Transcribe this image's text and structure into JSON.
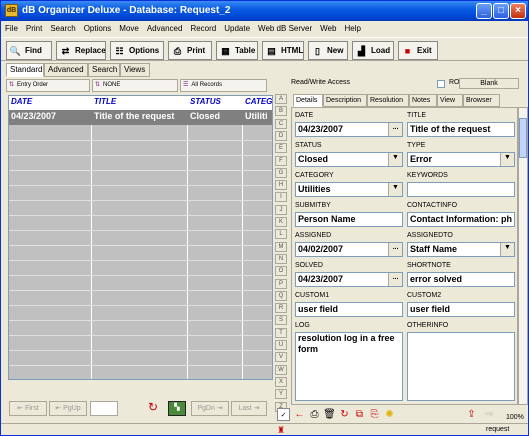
{
  "window": {
    "title": "dB Organizer Deluxe - Database: Request_2",
    "app_icon": "app-icon"
  },
  "menu": [
    "File",
    "Print",
    "Search",
    "Options",
    "Move",
    "Advanced",
    "Record",
    "Update",
    "Web dB Server",
    "Web",
    "Help"
  ],
  "toolbar": {
    "find": "Find",
    "replace": "Replace",
    "options": "Options",
    "print": "Print",
    "table": "Table",
    "html": "HTML",
    "new": "New",
    "load": "Load",
    "exit": "Exit"
  },
  "search_tabs": [
    "Standard",
    "Advanced",
    "Search",
    "Views"
  ],
  "sort_buttons": {
    "entry_order": "Entry Order",
    "none": "NONE",
    "all_records": "All Records"
  },
  "grid": {
    "columns": [
      "DATE",
      "TITLE",
      "STATUS",
      "CATEG"
    ],
    "rows": [
      [
        "04/23/2007",
        "Title of the request",
        "Closed",
        "Utiliti"
      ]
    ]
  },
  "nav": {
    "first": "First",
    "pgup": "PgUp",
    "pgdn": "PgDn",
    "last": "Last"
  },
  "form": {
    "access": "Read/Write Access",
    "ro": "RO",
    "blank": "Blank",
    "tabs": [
      "Details",
      "Description",
      "Resolution",
      "Notes",
      "View",
      "Browser"
    ],
    "alpha": [
      "A",
      "B",
      "C",
      "D",
      "E",
      "F",
      "G",
      "H",
      "I",
      "J",
      "K",
      "L",
      "M",
      "N",
      "O",
      "P",
      "Q",
      "R",
      "S",
      "T",
      "U",
      "V",
      "W",
      "X",
      "Y",
      "Z"
    ],
    "fields": {
      "date": {
        "label": "DATE",
        "value": "04/23/2007"
      },
      "title": {
        "label": "TITLE",
        "value": "Title of the request"
      },
      "status": {
        "label": "STATUS",
        "value": "Closed"
      },
      "type": {
        "label": "TYPE",
        "value": "Error"
      },
      "category": {
        "label": "CATEGORY",
        "value": "Utilities"
      },
      "keywords": {
        "label": "KEYWORDS",
        "value": ""
      },
      "submitby": {
        "label": "SUBMITBY",
        "value": "Person Name"
      },
      "contactinfo": {
        "label": "CONTACTINFO",
        "value": "Contact Information: ph"
      },
      "assigned": {
        "label": "ASSIGNED",
        "value": "04/02/2007"
      },
      "assignedto": {
        "label": "ASSIGNEDTO",
        "value": "Staff Name"
      },
      "solved": {
        "label": "SOLVED",
        "value": "04/23/2007"
      },
      "shortnote": {
        "label": "SHORTNOTE",
        "value": "error solved"
      },
      "custom1": {
        "label": "CUSTOM1",
        "value": "user field"
      },
      "custom2": {
        "label": "CUSTOM2",
        "value": "user field"
      },
      "log": {
        "label": "LOG",
        "value": "resolution log in a free form"
      },
      "otherinfo": {
        "label": "OTHERINFO",
        "value": ""
      }
    },
    "ellipsis": "...",
    "dropdown_glyph": "▼"
  },
  "status": {
    "zoom": "100%",
    "name": "request"
  }
}
